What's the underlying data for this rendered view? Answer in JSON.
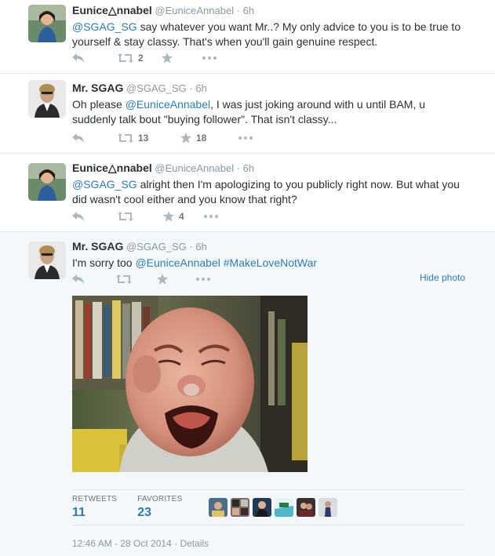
{
  "tweets": [
    {
      "fullname": "Eunice△nnabel",
      "screenname": "@EuniceAnnabel",
      "time": "6h",
      "text_parts": [
        {
          "type": "mention",
          "text": "@SGAG_SG"
        },
        {
          "type": "text",
          "text": " say whatever you want Mr..? My only advice to you is to be true to yourself & stay classy. That's when you'll gain genuine respect."
        }
      ],
      "retweets": "2",
      "favorites": ""
    },
    {
      "fullname": "Mr. SGAG",
      "screenname": "@SGAG_SG",
      "time": "6h",
      "text_parts": [
        {
          "type": "text",
          "text": "Oh please "
        },
        {
          "type": "mention",
          "text": "@EuniceAnnabel"
        },
        {
          "type": "text",
          "text": ", I was just joking around with u until BAM, u suddenly talk bout \"buying follower\". That isn't classy..."
        }
      ],
      "retweets": "13",
      "favorites": "18"
    },
    {
      "fullname": "Eunice△nnabel",
      "screenname": "@EuniceAnnabel",
      "time": "6h",
      "text_parts": [
        {
          "type": "mention",
          "text": "@SGAG_SG"
        },
        {
          "type": "text",
          "text": " alright then I'm apologizing to you publicly right now. But what you did wasn't cool either and you know that right?"
        }
      ],
      "retweets": "",
      "favorites": "4"
    },
    {
      "fullname": "Mr. SGAG",
      "screenname": "@SGAG_SG",
      "time": "6h",
      "text_parts": [
        {
          "type": "text",
          "text": "I'm sorry too "
        },
        {
          "type": "mention",
          "text": "@EuniceAnnabel"
        },
        {
          "type": "text",
          "text": " "
        },
        {
          "type": "hashtag",
          "text": "#MakeLoveNotWar"
        }
      ],
      "retweets": "",
      "favorites": ""
    }
  ],
  "separator": "·",
  "hide_photo_label": "Hide photo",
  "stats": {
    "retweets_label": "RETWEETS",
    "retweets_value": "11",
    "favorites_label": "FAVORITES",
    "favorites_value": "23"
  },
  "timestamp": "12:46 AM - 28 Oct 2014",
  "details_label": "Details",
  "icons": [
    "reply-icon",
    "retweet-icon",
    "favorite-icon",
    "more-icon"
  ],
  "colors": {
    "link": "#2b7bb9",
    "muted": "#8899a6",
    "text": "#292f33",
    "divider": "#e1e8ed",
    "focused_bg": "#f5f8fa"
  }
}
